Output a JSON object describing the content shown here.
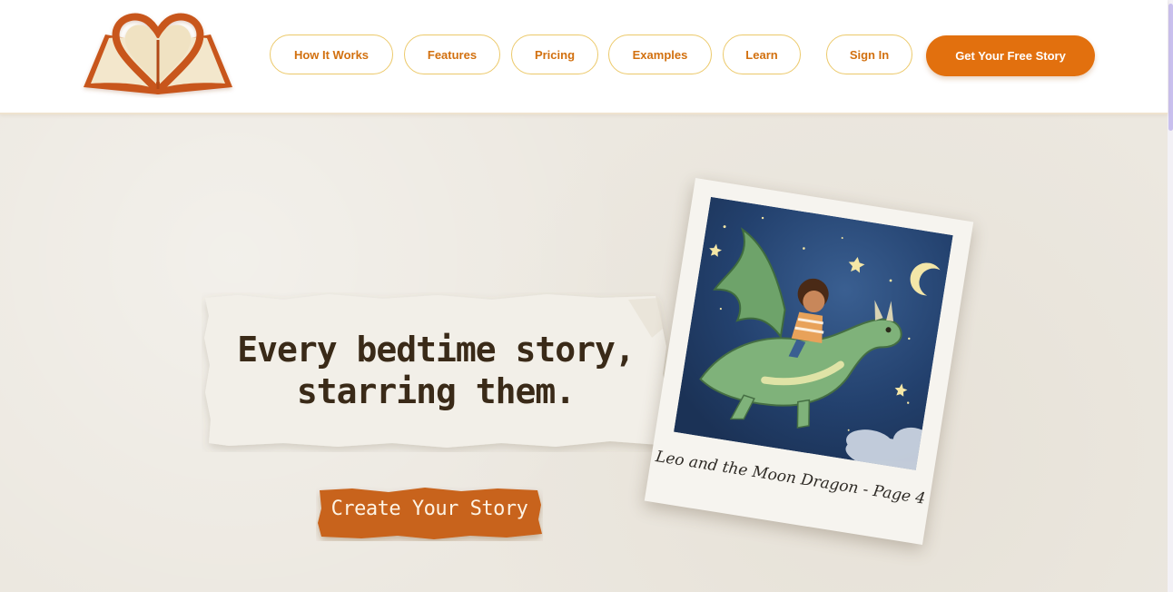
{
  "header": {
    "logo_alt": "open book with heart",
    "nav": [
      {
        "label": "How It Works"
      },
      {
        "label": "Features"
      },
      {
        "label": "Pricing"
      },
      {
        "label": "Examples"
      },
      {
        "label": "Learn"
      }
    ],
    "sign_in_label": "Sign In",
    "cta_label": "Get Your Free Story"
  },
  "hero": {
    "headline_line1": "Every bedtime story,",
    "headline_line2": "starring them.",
    "create_button_label": "Create Your Story",
    "polaroid_caption": "Leo and the Moon Dragon - Page 4"
  },
  "colors": {
    "accent": "#e2700e",
    "nav_text": "#d2700f",
    "nav_border": "#ecc96a",
    "hero_bg": "#ece8e0",
    "button_paper": "#c8631a"
  }
}
